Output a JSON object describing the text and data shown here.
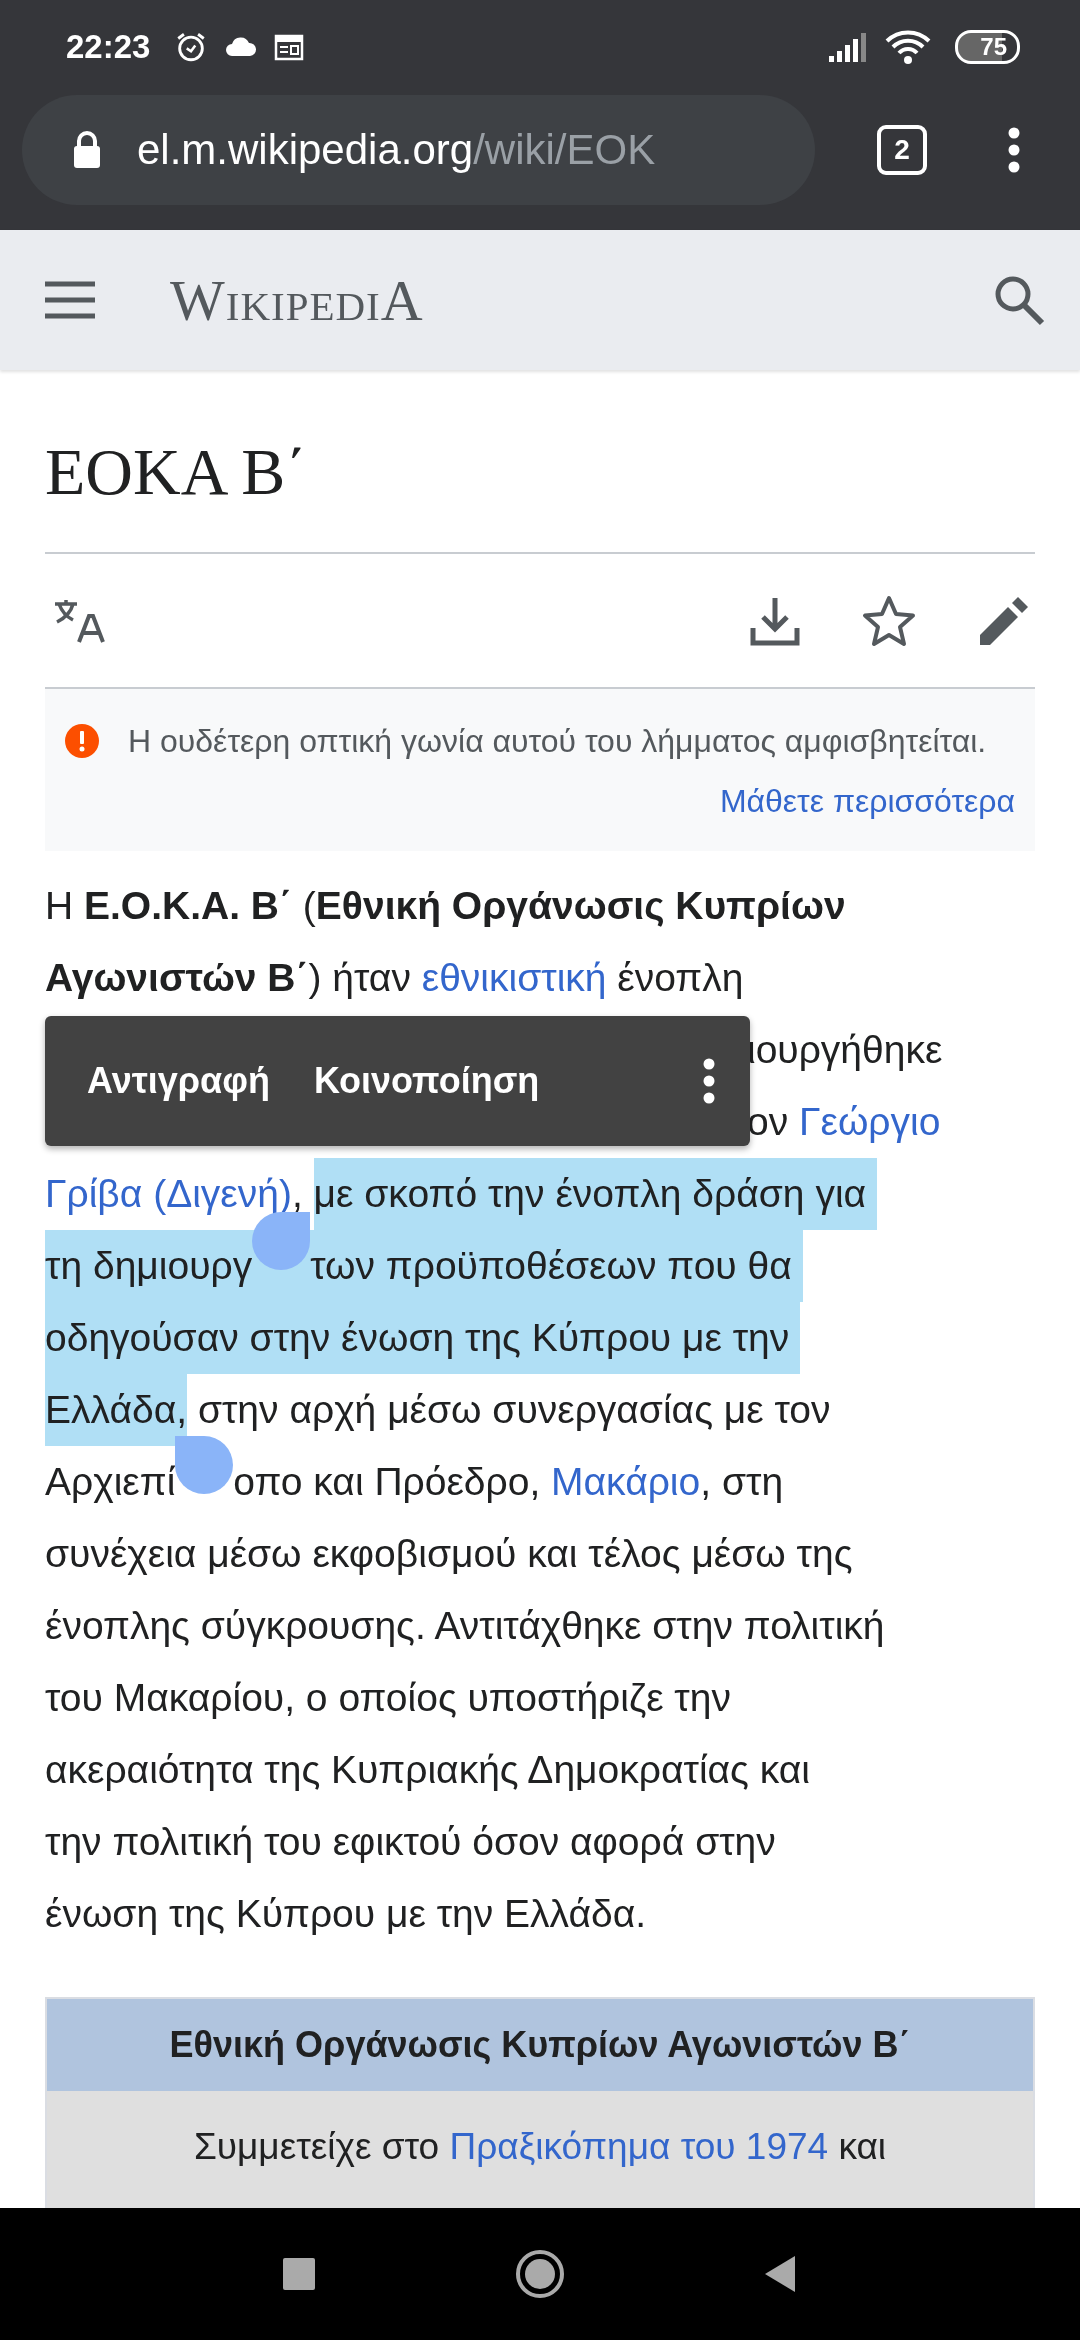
{
  "status_bar": {
    "time": "22:23",
    "battery": "75"
  },
  "browser": {
    "url_host": "el.m.wikipedia.org",
    "url_path": "/wiki/EOK",
    "tab_count": "2"
  },
  "header": {
    "logo": "WikipediA"
  },
  "article": {
    "title": "ΕΟΚΑ Β΄"
  },
  "notice": {
    "text": "Η ουδέτερη οπτική γωνία αυτού του λήμματος αμφισβητείται.",
    "link": "Μάθετε περισσότερα"
  },
  "selection_menu": {
    "items": [
      "Αντιγραφή",
      "Κοινοποίηση"
    ]
  },
  "paragraph": {
    "lines": [
      {
        "kind": "full",
        "segments": [
          {
            "kind": "text",
            "text": "Η **Ε.Ο.Κ.Α. Β΄** (**Εθνική Οργάνωσις Κυπρίων**",
            "selected": false
          }
        ]
      },
      {
        "kind": "full",
        "segments": [
          {
            "kind": "text",
            "text": "**Αγωνιστών Β΄**) ήταν ",
            "selected": false
          },
          {
            "kind": "link",
            "text": "εθνικιστική",
            "selected": false
          },
          {
            "kind": "text",
            "text": " ένοπλη",
            "selected": false
          }
        ]
      },
      {
        "kind": "under-menu",
        "segments": [
          {
            "kind": "text",
            "text": "ιουργήθηκε",
            "selected": false
          }
        ]
      },
      {
        "kind": "under-menu",
        "segments": [
          {
            "kind": "text",
            "text": "ον ",
            "selected": false
          },
          {
            "kind": "link",
            "text": "Γεώργιο",
            "selected": false
          }
        ]
      },
      {
        "kind": "full",
        "segments": [
          {
            "kind": "link",
            "text": "Γρίβα (Διγενή)",
            "selected": false
          },
          {
            "kind": "text",
            "text": ", ",
            "selected": false
          },
          {
            "kind": "text",
            "text": "με σκοπό την ένοπλη δράση για ",
            "selected": true
          }
        ]
      },
      {
        "kind": "full",
        "segments": [
          {
            "kind": "text",
            "text": "τη δημιουργ",
            "selected": true
          },
          {
            "kind": "start-handle",
            "selected": true
          },
          {
            "kind": "text",
            "text": "των προϋποθέσεων που θα ",
            "selected": true
          }
        ]
      },
      {
        "kind": "full",
        "segments": [
          {
            "kind": "text",
            "text": "οδηγούσαν στην ένωση της Κύπρου με την ",
            "selected": true
          }
        ]
      },
      {
        "kind": "full",
        "segments": [
          {
            "kind": "text",
            "text": "Ελλάδα,",
            "selected": true
          },
          {
            "kind": "text",
            "text": " στην αρχή μέσω συνεργασίας με τον",
            "selected": false
          }
        ]
      },
      {
        "kind": "full",
        "segments": [
          {
            "kind": "text",
            "text": "Αρχιεπί",
            "selected": false
          },
          {
            "kind": "end-handle",
            "selected": false
          },
          {
            "kind": "text",
            "text": "οπο και Πρόεδρο, ",
            "selected": false
          },
          {
            "kind": "link",
            "text": "Μακάριο",
            "selected": false
          },
          {
            "kind": "text",
            "text": ", στη",
            "selected": false
          }
        ]
      },
      {
        "kind": "full",
        "segments": [
          {
            "kind": "text",
            "text": "συνέχεια μέσω εκφοβισμού και τέλος μέσω της",
            "selected": false
          }
        ]
      },
      {
        "kind": "full",
        "segments": [
          {
            "kind": "text",
            "text": "ένοπλης σύγκρουσης. Αντιτάχθηκε στην πολιτική",
            "selected": false
          }
        ]
      },
      {
        "kind": "full",
        "segments": [
          {
            "kind": "text",
            "text": "του Μακαρίου, ο οποίος υποστήριζε την",
            "selected": false
          }
        ]
      },
      {
        "kind": "full",
        "segments": [
          {
            "kind": "text",
            "text": "ακεραιότητα της Κυπριακής Δημοκρατίας και",
            "selected": false
          }
        ]
      },
      {
        "kind": "full",
        "segments": [
          {
            "kind": "text",
            "text": "την πολιτική του εφικτού όσον αφορά στην",
            "selected": false
          }
        ]
      },
      {
        "kind": "full",
        "segments": [
          {
            "kind": "text",
            "text": "ένωση της Κύπρου με την Ελλάδα.",
            "selected": false
          }
        ]
      }
    ]
  },
  "infobox": {
    "title": "Εθνική Οργάνωσις Κυπρίων Αγωνιστών Β΄",
    "segments": [
      {
        "kind": "text",
        "text": "Συμμετείχε στο "
      },
      {
        "kind": "link",
        "text": "Πραξικόπημα του 1974"
      },
      {
        "kind": "text",
        "text": " και"
      }
    ]
  }
}
